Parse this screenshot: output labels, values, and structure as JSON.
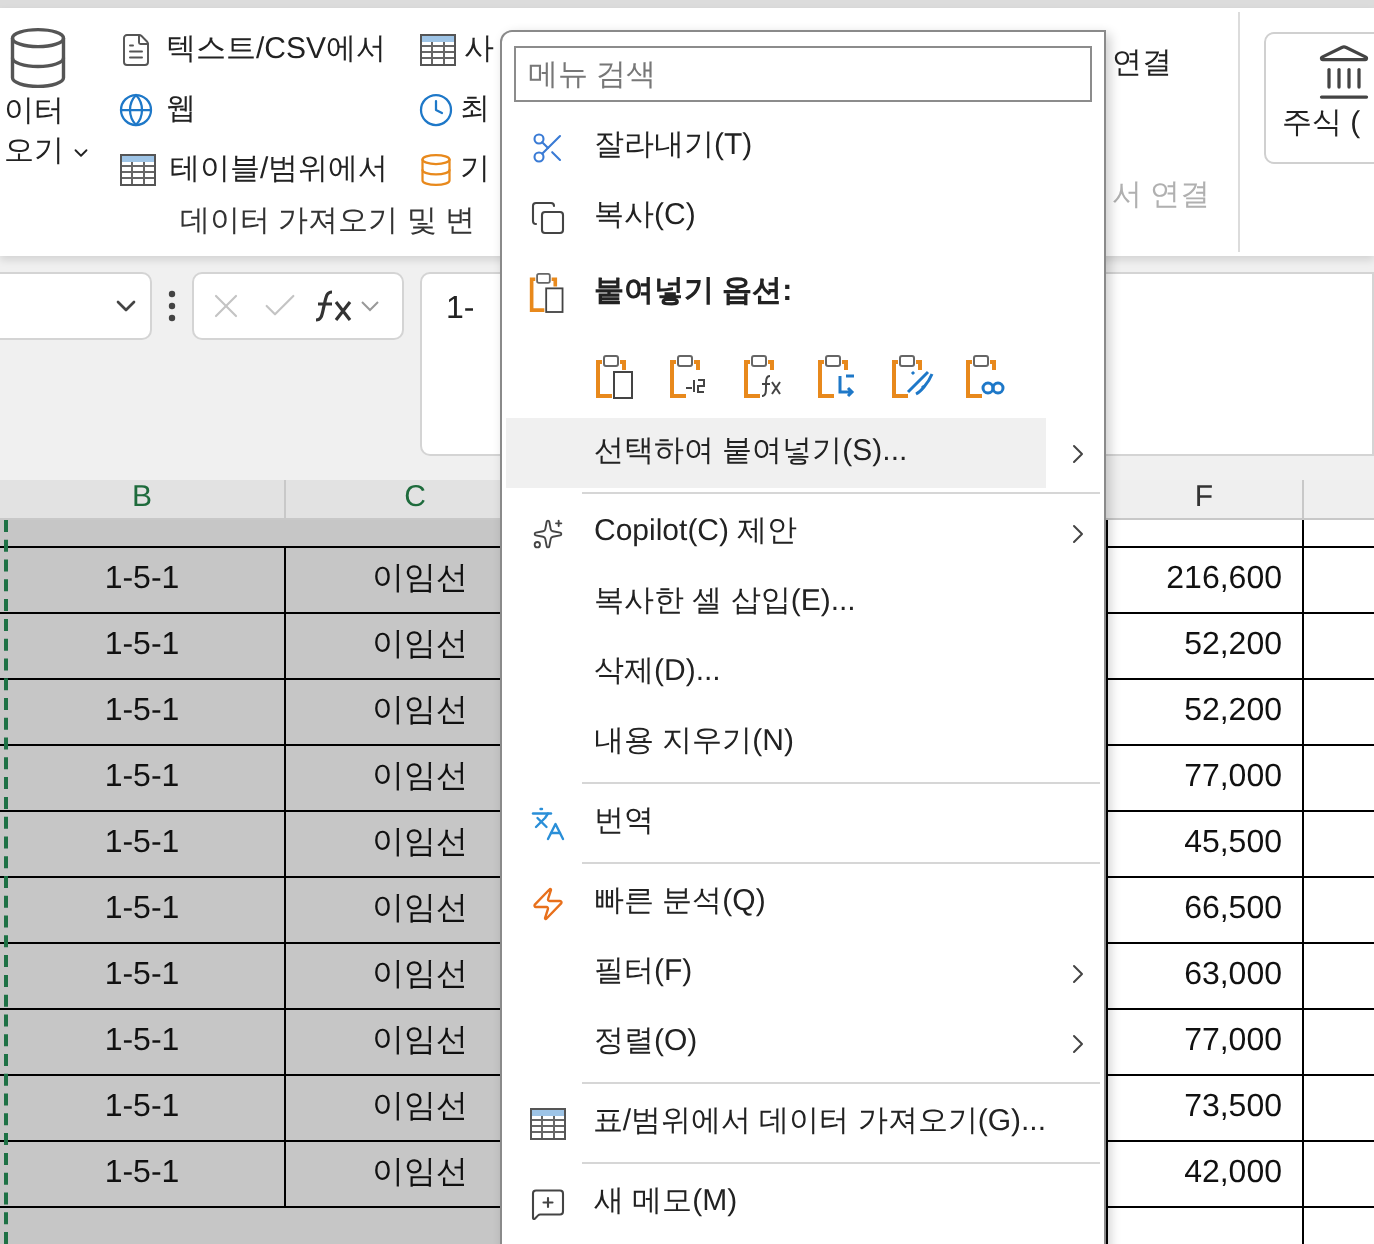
{
  "ribbon": {
    "get_data": {
      "label_lines": [
        "이터",
        "오기"
      ]
    },
    "sources": [
      {
        "label": "텍스트/CSV에서"
      },
      {
        "label": "웹"
      },
      {
        "label": "테이블/범위에서"
      }
    ],
    "sources_2": [
      {
        "label": "사"
      },
      {
        "label": "최"
      },
      {
        "label": "기"
      }
    ],
    "group_label": "데이터 가져오기 및 변",
    "connections": [
      {
        "label": "연결",
        "disabled": false
      },
      {
        "label": "서 연결",
        "disabled": true
      }
    ],
    "stocks": {
      "label": "주식 ("
    }
  },
  "formula_bar": {
    "formula": "1-"
  },
  "sheet": {
    "columns": [
      {
        "label": "B",
        "selected": true
      },
      {
        "label": "C",
        "selected": true
      },
      {
        "label": "F",
        "selected": false
      }
    ],
    "rows": [
      {
        "b": "1-5-1",
        "c": "이임선",
        "f": "216,600"
      },
      {
        "b": "1-5-1",
        "c": "이임선",
        "f": "52,200"
      },
      {
        "b": "1-5-1",
        "c": "이임선",
        "f": "52,200"
      },
      {
        "b": "1-5-1",
        "c": "이임선",
        "f": "77,000"
      },
      {
        "b": "1-5-1",
        "c": "이임선",
        "f": "45,500"
      },
      {
        "b": "1-5-1",
        "c": "이임선",
        "f": "66,500"
      },
      {
        "b": "1-5-1",
        "c": "이임선",
        "f": "63,000"
      },
      {
        "b": "1-5-1",
        "c": "이임선",
        "f": "77,000"
      },
      {
        "b": "1-5-1",
        "c": "이임선",
        "f": "73,500"
      },
      {
        "b": "1-5-1",
        "c": "이임선",
        "f": "42,000"
      }
    ]
  },
  "context_menu": {
    "search": {
      "placeholder": "메뉴 검색"
    },
    "items": [
      {
        "kind": "command",
        "label": "잘라내기(T)",
        "highlighted": false,
        "submenu": false
      },
      {
        "kind": "command",
        "label": "복사(C)",
        "highlighted": false,
        "submenu": false
      },
      {
        "kind": "header",
        "label": "붙여넣기 옵션:"
      },
      {
        "kind": "paste_options"
      },
      {
        "kind": "command",
        "label": "선택하여 붙여넣기(S)...",
        "highlighted": true,
        "submenu": true
      },
      {
        "kind": "separator"
      },
      {
        "kind": "command",
        "label": "Copilot(C) 제안",
        "highlighted": false,
        "submenu": true
      },
      {
        "kind": "command",
        "label": "복사한 셀 삽입(E)...",
        "highlighted": false,
        "submenu": false
      },
      {
        "kind": "command",
        "label": "삭제(D)...",
        "highlighted": false,
        "submenu": false
      },
      {
        "kind": "command",
        "label": "내용 지우기(N)",
        "highlighted": false,
        "submenu": false
      },
      {
        "kind": "separator"
      },
      {
        "kind": "command",
        "label": "번역",
        "highlighted": false,
        "submenu": false
      },
      {
        "kind": "separator"
      },
      {
        "kind": "command",
        "label": "빠른 분석(Q)",
        "highlighted": false,
        "submenu": false
      },
      {
        "kind": "command",
        "label": "필터(F)",
        "highlighted": false,
        "submenu": true
      },
      {
        "kind": "command",
        "label": "정렬(O)",
        "highlighted": false,
        "submenu": true
      },
      {
        "kind": "separator"
      },
      {
        "kind": "command",
        "label": "표/범위에서 데이터 가져오기(G)...",
        "highlighted": false,
        "submenu": false
      },
      {
        "kind": "separator"
      },
      {
        "kind": "command",
        "label": "새 메모(M)",
        "highlighted": false,
        "submenu": false
      }
    ]
  }
}
